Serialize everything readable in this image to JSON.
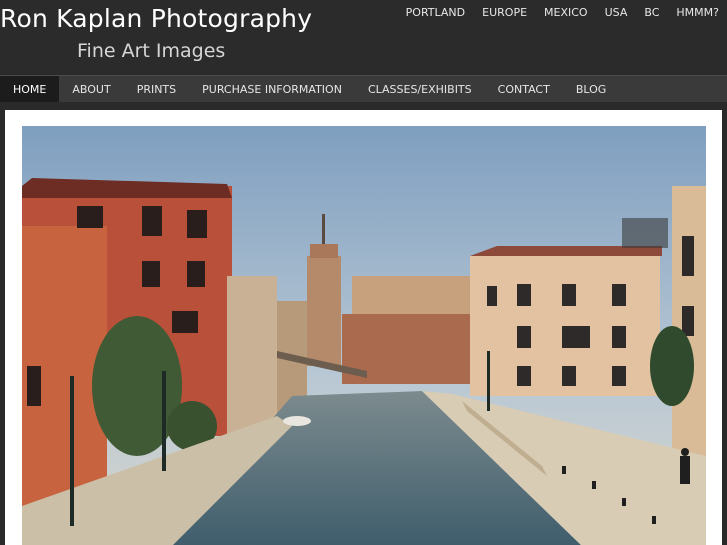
{
  "site": {
    "title": "Ron Kaplan Photography",
    "subtitle": "Fine Art Images"
  },
  "top_links": [
    {
      "label": "PORTLAND"
    },
    {
      "label": "EUROPE"
    },
    {
      "label": "MEXICO"
    },
    {
      "label": "USA"
    },
    {
      "label": "BC"
    },
    {
      "label": "HMMM?"
    }
  ],
  "nav": [
    {
      "label": "HOME",
      "active": true
    },
    {
      "label": "ABOUT"
    },
    {
      "label": "PRINTS"
    },
    {
      "label": "PURCHASE INFORMATION"
    },
    {
      "label": "CLASSES/EXHIBITS"
    },
    {
      "label": "CONTACT"
    },
    {
      "label": "BLOG"
    }
  ],
  "colors": {
    "header_bg": "#2b2b2b",
    "nav_bg": "#3a3a3a",
    "nav_active_bg": "#1c1c1c",
    "content_bg": "#ffffff"
  },
  "photo": {
    "icon": "venice-canal-photo"
  }
}
